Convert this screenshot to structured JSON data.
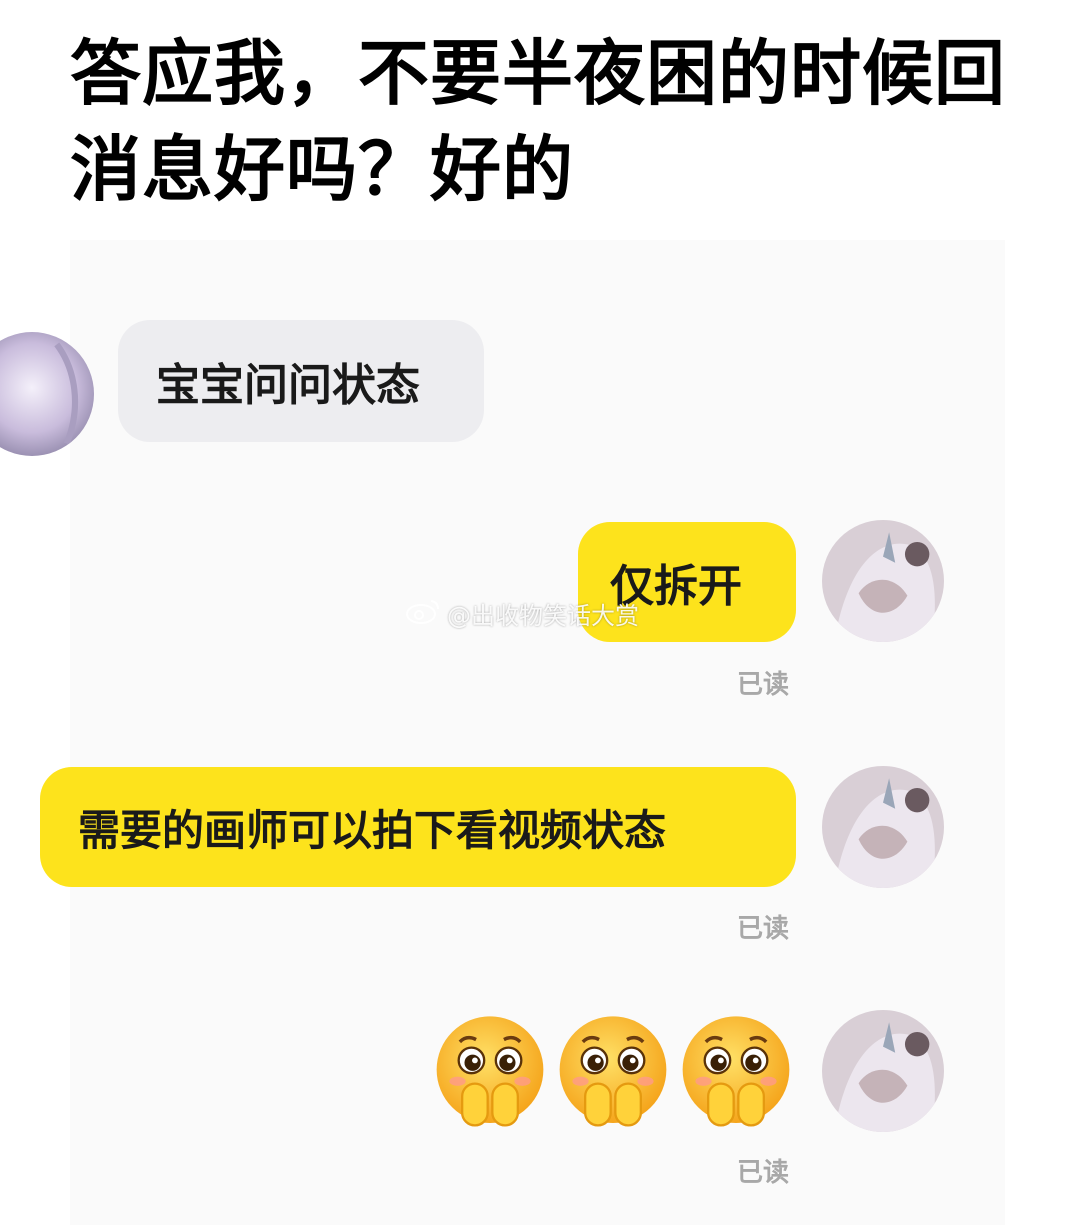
{
  "title": "答应我，不要半夜困的时候回消息好吗？好的",
  "messages": [
    {
      "sender": "them",
      "text": "宝宝问问状态"
    },
    {
      "sender": "me",
      "text": "仅拆开",
      "status": "已读"
    },
    {
      "sender": "me",
      "text": "需要的画师可以拍下看视频状态",
      "status": "已读"
    },
    {
      "sender": "me",
      "emoji": "pleading-hands-emoji",
      "count": 3,
      "status": "已读"
    }
  ],
  "watermark": {
    "icon": "weibo-icon",
    "text": "@出收物笑话大赏"
  },
  "colors": {
    "my_bubble": "#fde31c",
    "their_bubble": "#ededf0",
    "read_status": "#a8a8a8"
  }
}
